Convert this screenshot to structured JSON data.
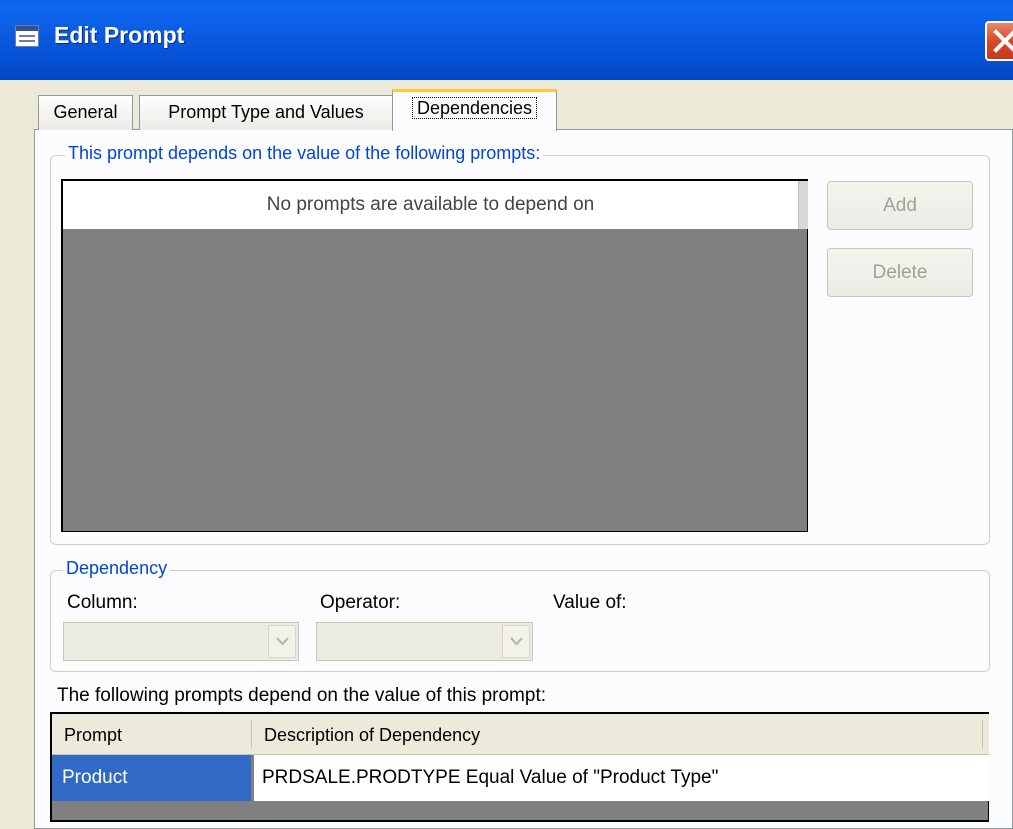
{
  "window": {
    "title": "Edit Prompt"
  },
  "tabs": [
    {
      "label": "General",
      "active": false
    },
    {
      "label": "Prompt Type and Values",
      "active": false
    },
    {
      "label": "Dependencies",
      "active": true
    }
  ],
  "depends_on": {
    "group_label": "This prompt depends on the value of the following prompts:",
    "empty_message": "No prompts are available to depend on",
    "add_label": "Add",
    "delete_label": "Delete"
  },
  "dependency": {
    "group_label": "Dependency",
    "column_label": "Column:",
    "operator_label": "Operator:",
    "value_of_label": "Value of:"
  },
  "dependents": {
    "caption": "The following prompts depend on the value of this prompt:",
    "columns": [
      "Prompt",
      "Description of Dependency"
    ],
    "rows": [
      {
        "prompt": "Product",
        "description": "PRDSALE.PRODTYPE Equal Value of \"Product Type\""
      }
    ]
  },
  "colors": {
    "titlebar": "#0552d6",
    "selection": "#316ac5",
    "group_label": "#0046d5",
    "active_tab_accent": "#ffc83c"
  }
}
